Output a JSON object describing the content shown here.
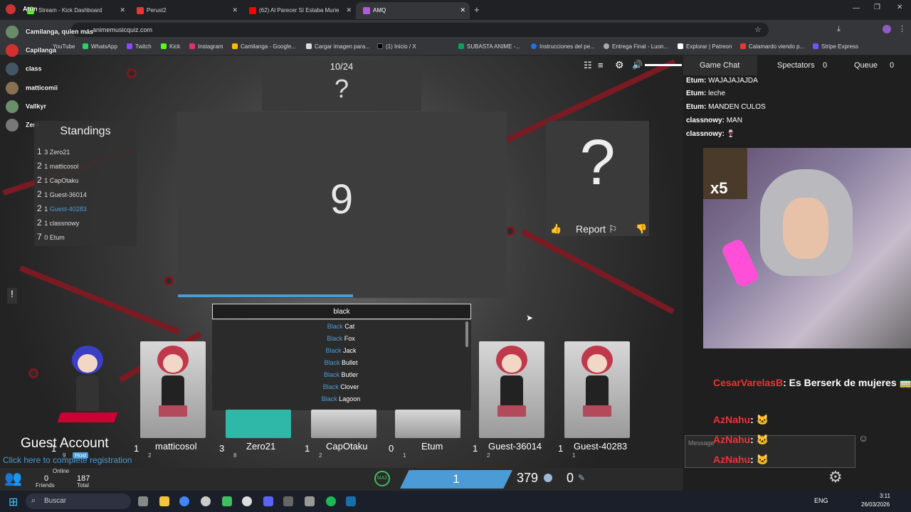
{
  "browser": {
    "tabs": [
      {
        "label": "Stream - Kick Dashboard",
        "color": "#53fc18"
      },
      {
        "label": "Perust2",
        "color": "#e53935"
      },
      {
        "label": "(62) Al Parecer Sí Estaba Murie",
        "color": "#ff0000"
      },
      {
        "label": "AMQ",
        "color": "#b05cd8"
      }
    ],
    "url": "animemusicquiz.com",
    "bookmarks": [
      "YouTube",
      "WhatsApp",
      "Twitch",
      "Kick",
      "Instagram",
      "Camilanga - Google...",
      "Cargar imagen para...",
      "(1) Inicio / X",
      "SUBASTA ANIME -...",
      "Instrucciones del pe...",
      "Entrega Final - Luon...",
      "Explorar | Patreon",
      "Calamardo viendo p...",
      "Stripe Express"
    ]
  },
  "overlay_viewers": [
    "Atún",
    "Camilanga, quien más",
    "Capilanga",
    "class",
    "matticomii",
    "Vallkyr",
    "Zero"
  ],
  "game": {
    "song_counter": "10/24",
    "counter_question": "?",
    "countdown": "9",
    "answer_question": "?",
    "report_label": "Report",
    "answer_input": "black",
    "dropdown_hl": "Black",
    "dropdown_options": [
      " Cat",
      " Fox",
      " Jack",
      " Bullet",
      " Butler",
      " Clover",
      " Lagoon"
    ],
    "standings": {
      "title": "Standings",
      "rows": [
        {
          "pos": "1",
          "score": "3",
          "name": "Zero21"
        },
        {
          "pos": "2",
          "score": "1",
          "name": "matticosol"
        },
        {
          "pos": "2",
          "score": "1",
          "name": "CapOtaku"
        },
        {
          "pos": "2",
          "score": "1",
          "name": "Guest-36014"
        },
        {
          "pos": "2",
          "score": "1",
          "name": "Guest-40283"
        },
        {
          "pos": "2",
          "score": "1",
          "name": "classnowy"
        },
        {
          "pos": "7",
          "score": "0",
          "name": "Etum"
        }
      ]
    },
    "players": [
      {
        "name": "classnowy",
        "score": "1",
        "level": "9",
        "host": "Host"
      },
      {
        "name": "matticosol",
        "score": "1",
        "level": "2"
      },
      {
        "name": "Zero21",
        "score": "3",
        "level": "8"
      },
      {
        "name": "CapOtaku",
        "score": "1",
        "level": "2"
      },
      {
        "name": "Etum",
        "score": "0",
        "level": "1"
      },
      {
        "name": "Guest-36014",
        "score": "1",
        "level": "2"
      },
      {
        "name": "Guest-40283",
        "score": "1",
        "level": "1"
      }
    ],
    "guest_account": "Guest Account",
    "register_link": "Click here to complete registration",
    "online_label": "Online",
    "friends_count": "0",
    "friends_label": "Friends",
    "total_count": "187",
    "total_label": "Total",
    "footer_center": "1",
    "currency1": "379",
    "currency2": "0"
  },
  "chat": {
    "tabs": [
      {
        "label": "Game Chat"
      },
      {
        "label": "Spectators",
        "count": "0"
      },
      {
        "label": "Queue",
        "count": "0"
      }
    ],
    "messages": [
      {
        "user": "Etum:",
        "text": "WAJAJAJAJDA"
      },
      {
        "user": "Etum:",
        "text": "leche"
      },
      {
        "user": "Etum:",
        "text": "MANDEN CULOS"
      },
      {
        "user": "classnowy:",
        "text": "MAN"
      },
      {
        "user": "classnowy:",
        "text": "🍷"
      }
    ],
    "message_placeholder": "Message",
    "stream_chat": [
      {
        "user": "CesarVarelasB",
        "text": ": Es Berserk de mujeres 🚃"
      },
      {
        "user": "AzNahu",
        "text": ": 🐱"
      },
      {
        "user": "AzNahu",
        "text": ": 🐱"
      },
      {
        "user": "AzNahu",
        "text": ": 🐱"
      }
    ],
    "sticker_text": "x5"
  },
  "taskbar": {
    "search": "Buscar",
    "lang": "ENG",
    "time": "3:11",
    "date": "26/03/2026"
  }
}
